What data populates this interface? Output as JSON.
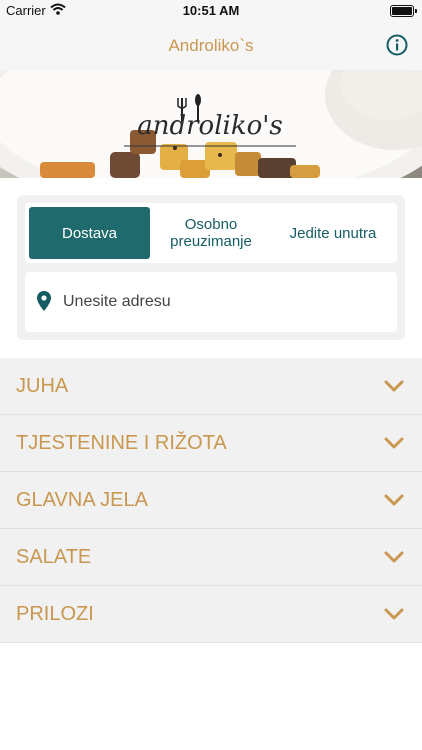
{
  "status_bar": {
    "carrier": "Carrier",
    "time": "10:51 AM"
  },
  "nav": {
    "title": "Androliko`s",
    "info_icon": "info-icon"
  },
  "banner": {
    "logo_text": "androliko's"
  },
  "order_modes": {
    "tabs": [
      {
        "label": "Dostava",
        "active": true
      },
      {
        "label": "Osobno preuzimanje",
        "active": false
      },
      {
        "label": "Jedite unutra",
        "active": false
      }
    ],
    "address_placeholder": "Unesite adresu"
  },
  "menu": {
    "categories": [
      {
        "label": "JUHA"
      },
      {
        "label": "TJESTENINE I RIŽOTA"
      },
      {
        "label": "GLAVNA JELA"
      },
      {
        "label": "SALATE"
      },
      {
        "label": "PRILOZI"
      }
    ]
  },
  "colors": {
    "accent_gold": "#c9974f",
    "accent_teal": "#1f6a6c",
    "background_gray": "#f1f1f1"
  }
}
